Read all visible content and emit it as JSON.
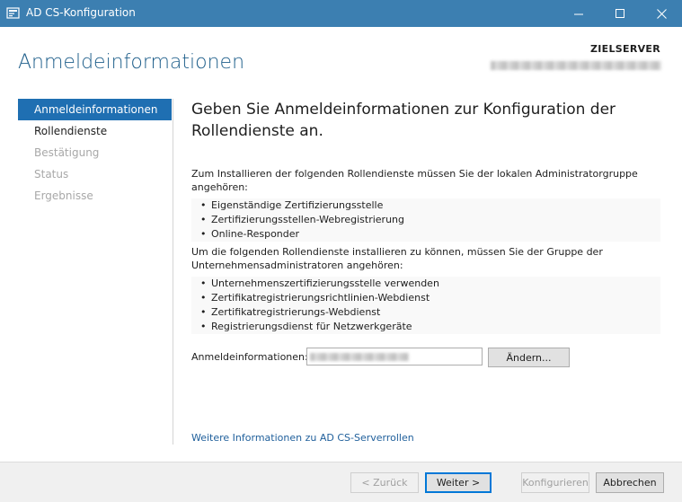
{
  "window": {
    "title": "AD CS-Konfiguration",
    "controls": {
      "minimize": "minimize-icon",
      "maximize": "maximize-icon",
      "close": "close-icon"
    }
  },
  "header": {
    "title": "Anmeldeinformationen",
    "target_label": "ZIELSERVER"
  },
  "nav": {
    "items": [
      {
        "label": "Anmeldeinformationen",
        "state": "active"
      },
      {
        "label": "Rollendienste",
        "state": "enabled"
      },
      {
        "label": "Bestätigung",
        "state": "disabled"
      },
      {
        "label": "Status",
        "state": "disabled"
      },
      {
        "label": "Ergebnisse",
        "state": "disabled"
      }
    ]
  },
  "content": {
    "heading": "Geben Sie Anmeldeinformationen zur Konfiguration der Rollendienste an.",
    "intro1": "Zum Installieren der folgenden Rollendienste müssen Sie der lokalen Administratorgruppe angehören:",
    "list1": [
      "Eigenständige Zertifizierungsstelle",
      "Zertifizierungsstellen-Webregistrierung",
      "Online-Responder"
    ],
    "intro2": "Um die folgenden Rollendienste installieren zu können, müssen Sie der Gruppe der Unternehmensadministratoren angehören:",
    "list2": [
      "Unternehmenszertifizierungsstelle verwenden",
      "Zertifikatregistrierungsrichtlinien-Webdienst",
      "Zertifikatregistrierungs-Webdienst",
      "Registrierungsdienst für Netzwerkgeräte"
    ],
    "credentials_label": "Anmeldeinformationen:",
    "change_button": "Ändern...",
    "more_info_link": "Weitere Informationen zu AD CS-Serverrollen"
  },
  "footer": {
    "back": "< Zurück",
    "next": "Weiter >",
    "configure": "Konfigurieren",
    "cancel": "Abbrechen"
  },
  "colors": {
    "titlebar": "#3c7fb1",
    "accent": "#1f6fb2",
    "header_text": "#1f5f8b"
  }
}
